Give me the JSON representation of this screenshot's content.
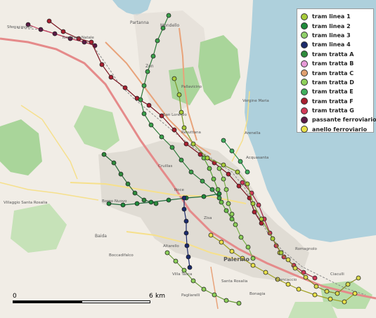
{
  "legend": {
    "items": [
      {
        "label": "tram linea 1",
        "color": "#a8cc3a"
      },
      {
        "label": "tram linea 2",
        "color": "#1f8b3b"
      },
      {
        "label": "tram linea 3",
        "color": "#8fd06a"
      },
      {
        "label": "tram linea 4",
        "color": "#1b2a6b"
      },
      {
        "label": "tram tratta A",
        "color": "#2e8b3c"
      },
      {
        "label": "tram tratta B",
        "color": "#e79ad8"
      },
      {
        "label": "tram tratta C",
        "color": "#e0a070"
      },
      {
        "label": "tram tratta D",
        "color": "#8ed05a"
      },
      {
        "label": "tram tratta E",
        "color": "#3fae5c"
      },
      {
        "label": "tram tratta F",
        "color": "#a82030"
      },
      {
        "label": "tram tratta G",
        "color": "#d13a58"
      },
      {
        "label": "passante ferroviario",
        "color": "#5c1a45"
      },
      {
        "label": "anello ferroviario",
        "color": "#e8e04a"
      }
    ]
  },
  "scale": {
    "start": "0",
    "end": "6",
    "unit": "km"
  },
  "places": {
    "palermo": "Palermo",
    "mondello": "Mondello",
    "tommaso_natale": "Tommaso Natale",
    "sferracavallo": "Sferracavallo",
    "zen": "Zen",
    "pallavicino": "Pallavicino",
    "partanna": "Partanna",
    "vergine_maria": "Vergine Maria",
    "arenella": "Arenella",
    "acquasanta": "Acquasanta",
    "san_lorenzo": "San Lorenzo",
    "resuttana": "Resuttana",
    "cruillas": "Cruillas",
    "borgo_nuovo": "Borgo Nuovo",
    "boccadifalco": "Boccadifalco",
    "baida": "Baida",
    "altarello": "Altarello",
    "villa_tasca": "Villa Tasca",
    "pagliarelli": "Pagliarelli",
    "santa_rosalia": "Santa Rosalia",
    "brancaccio": "Brancaccio",
    "romagnolo": "Romagnolo",
    "bonagia": "Bonagia",
    "ciaculli": "Ciaculli",
    "villaggio": "Villaggio Santa Rosalia",
    "noce": "Noce",
    "zisa": "Zisa"
  },
  "routes": {
    "L1": [
      [
        248,
        112
      ],
      [
        255,
        135
      ],
      [
        258,
        160
      ],
      [
        262,
        182
      ],
      [
        275,
        205
      ],
      [
        295,
        225
      ],
      [
        318,
        235
      ],
      [
        338,
        245
      ],
      [
        352,
        262
      ],
      [
        360,
        290
      ],
      [
        372,
        312
      ],
      [
        388,
        340
      ],
      [
        400,
        360
      ]
    ],
    "L2": [
      [
        155,
        290
      ],
      [
        175,
        292
      ],
      [
        195,
        290
      ],
      [
        215,
        288
      ],
      [
        240,
        285
      ],
      [
        265,
        282
      ],
      [
        290,
        280
      ],
      [
        312,
        276
      ]
    ],
    "L3": [
      [
        240,
        22
      ],
      [
        232,
        40
      ],
      [
        224,
        58
      ],
      [
        218,
        80
      ],
      [
        210,
        102
      ],
      [
        205,
        122
      ],
      [
        200,
        142
      ],
      [
        205,
        162
      ],
      [
        215,
        178
      ],
      [
        230,
        195
      ],
      [
        245,
        210
      ],
      [
        258,
        228
      ],
      [
        272,
        245
      ],
      [
        288,
        258
      ],
      [
        302,
        270
      ],
      [
        312,
        282
      ]
    ],
    "L4": [
      [
        262,
        282
      ],
      [
        262,
        298
      ],
      [
        265,
        315
      ],
      [
        265,
        332
      ],
      [
        266,
        350
      ],
      [
        268,
        366
      ],
      [
        270,
        381
      ]
    ],
    "A": [
      [
        148,
        220
      ],
      [
        162,
        232
      ],
      [
        172,
        248
      ],
      [
        182,
        262
      ],
      [
        192,
        275
      ],
      [
        205,
        285
      ],
      [
        222,
        290
      ]
    ],
    "C": [
      [
        312,
        240
      ],
      [
        318,
        255
      ],
      [
        322,
        270
      ],
      [
        325,
        290
      ],
      [
        330,
        305
      ],
      [
        335,
        320
      ],
      [
        343,
        338
      ],
      [
        353,
        352
      ],
      [
        360,
        368
      ]
    ],
    "D": [
      [
        290,
        225
      ],
      [
        298,
        240
      ],
      [
        304,
        255
      ],
      [
        310,
        270
      ],
      [
        315,
        288
      ],
      [
        322,
        300
      ],
      [
        330,
        312
      ]
    ],
    "E": [
      [
        318,
        200
      ],
      [
        330,
        215
      ],
      [
        342,
        230
      ],
      [
        352,
        245
      ]
    ],
    "F": [
      [
        70,
        30
      ],
      [
        90,
        45
      ],
      [
        112,
        55
      ],
      [
        130,
        60
      ],
      [
        145,
        92
      ],
      [
        158,
        110
      ],
      [
        178,
        125
      ],
      [
        195,
        140
      ],
      [
        212,
        150
      ],
      [
        230,
        165
      ],
      [
        248,
        185
      ],
      [
        265,
        205
      ],
      [
        285,
        220
      ],
      [
        305,
        232
      ],
      [
        325,
        248
      ],
      [
        340,
        265
      ],
      [
        355,
        282
      ],
      [
        362,
        302
      ],
      [
        372,
        318
      ]
    ],
    "G": [
      [
        345,
        260
      ],
      [
        358,
        275
      ],
      [
        368,
        292
      ],
      [
        376,
        312
      ],
      [
        384,
        332
      ],
      [
        393,
        350
      ],
      [
        404,
        366
      ],
      [
        418,
        378
      ],
      [
        432,
        388
      ],
      [
        448,
        396
      ]
    ],
    "passante": [
      [
        40,
        35
      ],
      [
        58,
        42
      ],
      [
        78,
        48
      ],
      [
        100,
        55
      ],
      [
        120,
        60
      ],
      [
        135,
        65
      ]
    ],
    "anello": [
      [
        300,
        335
      ],
      [
        315,
        345
      ],
      [
        330,
        358
      ],
      [
        345,
        368
      ],
      [
        360,
        378
      ],
      [
        378,
        388
      ],
      [
        395,
        398
      ],
      [
        410,
        405
      ],
      [
        425,
        412
      ],
      [
        448,
        420
      ],
      [
        470,
        426
      ],
      [
        490,
        430
      ],
      [
        505,
        418
      ]
    ],
    "green_misc": [
      [
        238,
        360
      ],
      [
        250,
        372
      ],
      [
        262,
        385
      ],
      [
        275,
        400
      ],
      [
        290,
        412
      ],
      [
        305,
        420
      ],
      [
        322,
        428
      ],
      [
        340,
        432
      ]
    ],
    "south_line": [
      [
        398,
        360
      ],
      [
        410,
        370
      ],
      [
        420,
        382
      ],
      [
        435,
        395
      ],
      [
        450,
        408
      ],
      [
        465,
        415
      ],
      [
        480,
        418
      ],
      [
        495,
        405
      ],
      [
        510,
        396
      ]
    ]
  },
  "route_styles": {
    "L1": {
      "fill": "#a8cc3a",
      "line": "#7a9a2a"
    },
    "L2": {
      "fill": "#1f8b3b",
      "line": "#1f6b3b"
    },
    "L3": {
      "fill": "#3aa04a",
      "line": "#2e7a3a"
    },
    "L4": {
      "fill": "#1b2a6b",
      "line": "#1b2a6b"
    },
    "A": {
      "fill": "#2e8b3c",
      "line": "#2e6b3c"
    },
    "C": {
      "fill": "#8ed05a",
      "line": "#7ab04a"
    },
    "D": {
      "fill": "#6cc04a",
      "line": "#5aa03a"
    },
    "E": {
      "fill": "#3fae5c",
      "line": "#2e8e4c"
    },
    "F": {
      "fill": "#a82030",
      "line": "#7a1520"
    },
    "G": {
      "fill": "#d13a58",
      "line": "#a02040"
    },
    "passante": {
      "fill": "#5c1a45",
      "line": "#c03a5a"
    },
    "anello": {
      "fill": "#e8e04a",
      "line": "#a0a020"
    },
    "green_misc": {
      "fill": "#8ed05a",
      "line": "#6a9a3a"
    },
    "south_line": {
      "fill": "#d8d84a",
      "line": "#8a8a2a"
    }
  },
  "colors": {
    "sea": "#aed0dc",
    "land": "#f1ede6",
    "park": "#a9d59a",
    "urban": "#dcd7cf",
    "road_main": "#e8a37a",
    "road_minor": "#f6e08c",
    "motorway": "#e58a8a"
  }
}
